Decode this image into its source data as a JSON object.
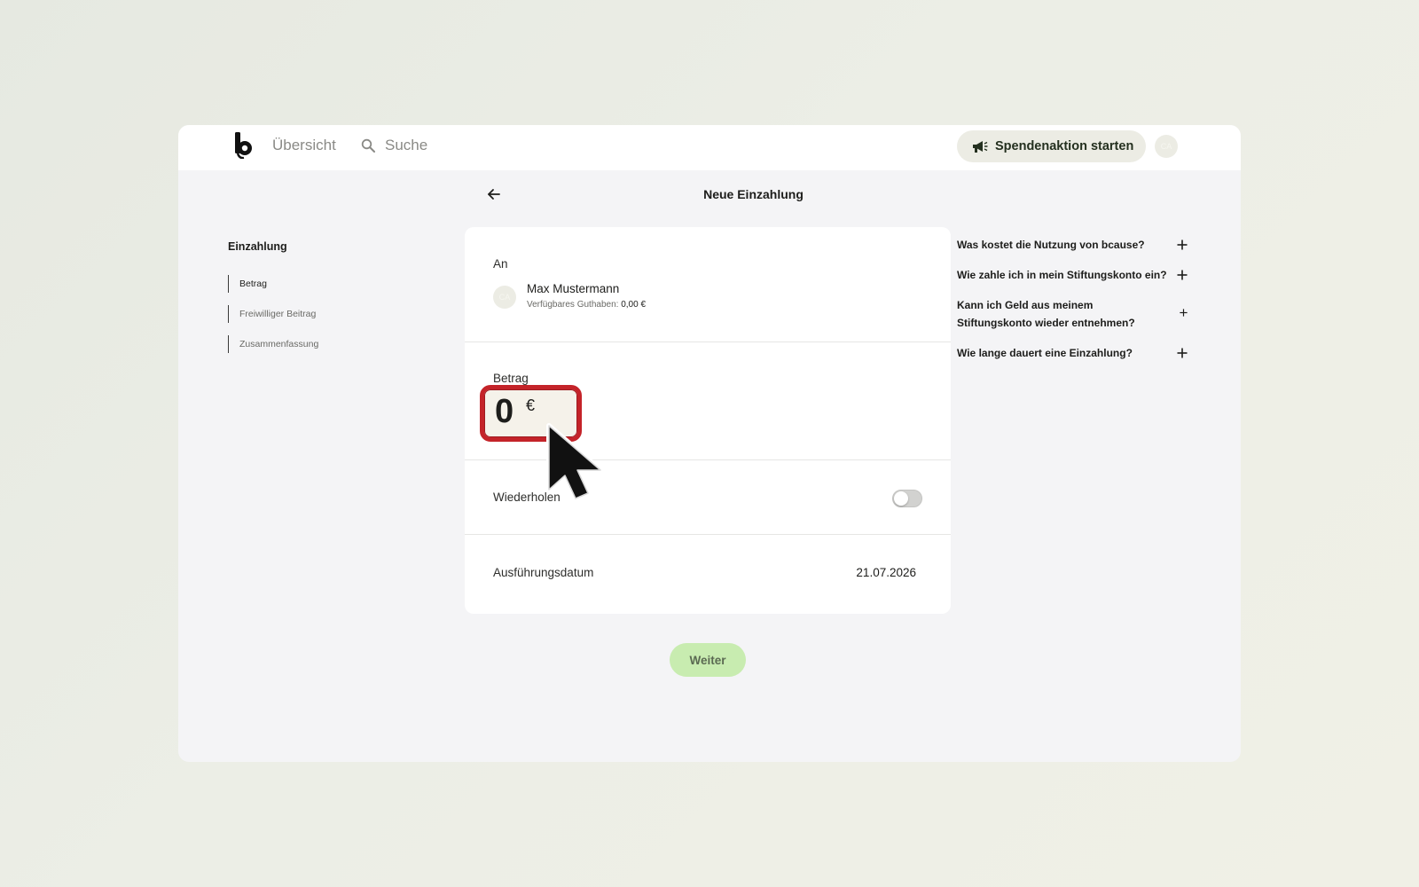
{
  "topbar": {
    "nav_overview": "Übersicht",
    "search_label": "Suche",
    "campaign_button": "Spendenaktion starten",
    "avatar_initials": "CA"
  },
  "page": {
    "title": "Neue Einzahlung"
  },
  "steps": {
    "title": "Einzahlung",
    "items": [
      {
        "label": "Betrag",
        "active": true
      },
      {
        "label": "Freiwilliger Beitrag",
        "active": false
      },
      {
        "label": "Zusammenfassung",
        "active": false
      }
    ]
  },
  "form": {
    "to_label": "An",
    "recipient": {
      "initials": "CA",
      "name": "Max Mustermann",
      "balance_label": "Verfügbares Guthaben:",
      "balance_value": "0,00 €"
    },
    "amount_label": "Betrag",
    "amount_value": "0",
    "currency": "€",
    "repeat_label": "Wiederholen",
    "repeat_enabled": false,
    "date_label": "Ausführungsdatum",
    "date_value": "21.07.2026",
    "next_button": "Weiter"
  },
  "faq": [
    "Was kostet die Nutzung von bcause?",
    "Wie zahle ich in mein Stiftungskonto ein?",
    "Kann ich Geld aus meinem Stiftungskonto wieder entnehmen?",
    "Wie lange dauert eine Einzahlung?"
  ],
  "colors": {
    "accent_highlight": "#c42329",
    "next_button_bg": "#c8ecb0",
    "campaign_button_bg": "#ecece4"
  }
}
